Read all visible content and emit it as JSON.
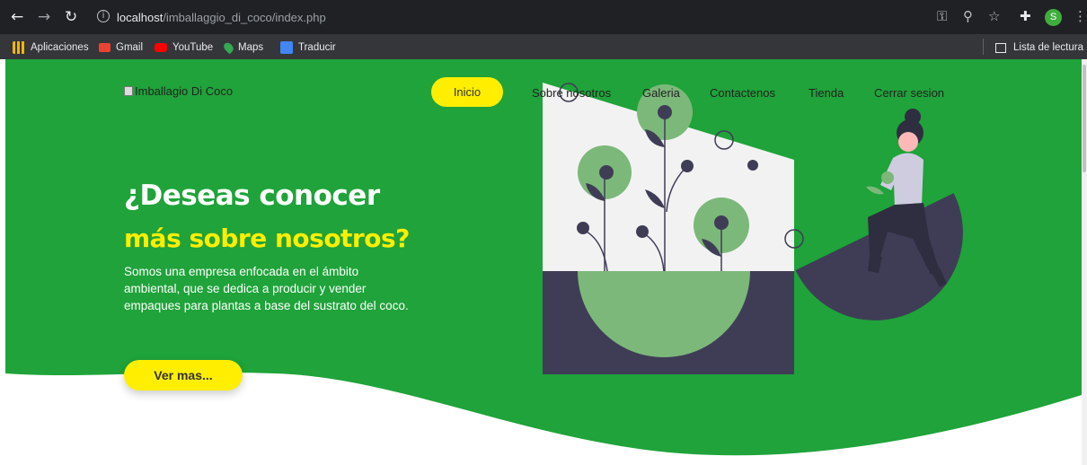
{
  "browser": {
    "url_host": "localhost",
    "url_path": "/imballaggio_di_coco/index.php",
    "profile_initial": "S",
    "icons": [
      "back-icon",
      "forward-icon",
      "reload-icon",
      "info-icon",
      "key-icon",
      "zoom-icon",
      "star-icon",
      "extensions-icon",
      "menu-icon"
    ]
  },
  "bookmarks": {
    "items": [
      {
        "label": "Aplicaciones",
        "icon": "apps-icon",
        "color": "#f4b400"
      },
      {
        "label": "Gmail",
        "icon": "gmail-icon",
        "color": "#ea4335"
      },
      {
        "label": "YouTube",
        "icon": "youtube-icon",
        "color": "#ff0000"
      },
      {
        "label": "Maps",
        "icon": "maps-icon",
        "color": "#34a853"
      },
      {
        "label": "Traducir",
        "icon": "translate-icon",
        "color": "#4285f4"
      }
    ],
    "reading_list": "Lista de lectura"
  },
  "site": {
    "logo_alt": "Imballagio Di Coco",
    "nav": {
      "inicio": "Inicio",
      "sobre": "Sobre nosotros",
      "galeria": "Galeria",
      "contactenos": "Contactenos",
      "tienda": "Tienda",
      "cerrar": "Cerrar sesion"
    },
    "hero": {
      "title_line1": "¿Deseas conocer",
      "title_line2": "más sobre nosotros?",
      "description": "Somos una empresa enfocada en el ámbito ambiental, que se dedica a producir y vender empaques para plantas a base del sustrato del coco.",
      "button": "Ver mas..."
    }
  },
  "colors": {
    "hero_green": "#1fa33a",
    "accent_yellow": "#ffee00",
    "plant_green": "#7cb87a",
    "dark_slate": "#3f3d56"
  }
}
